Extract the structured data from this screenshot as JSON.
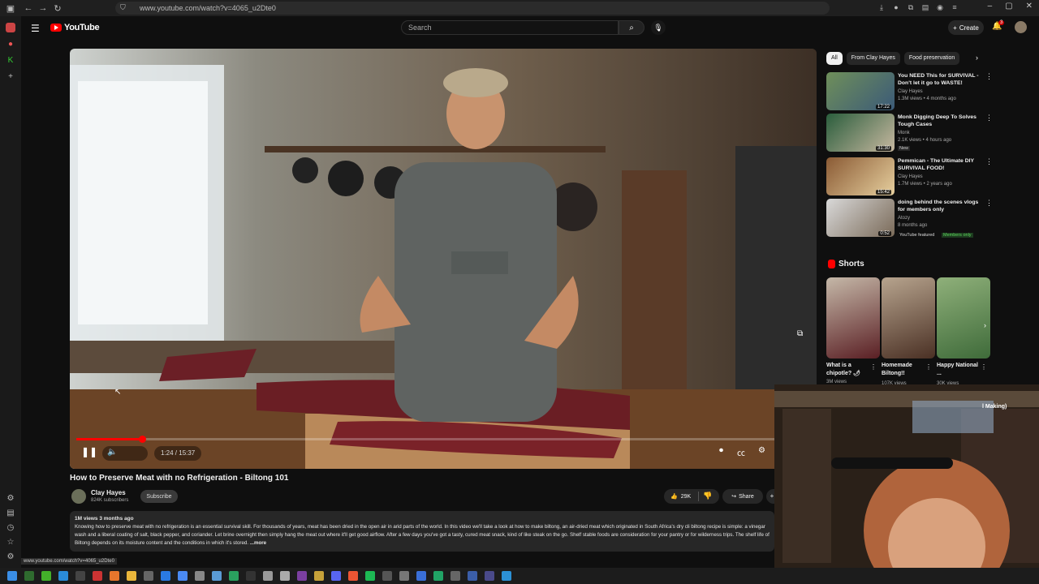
{
  "browser": {
    "url": "www.youtube.com/watch?v=4065_u2Dte0",
    "status_url": "www.youtube.com/watch?v=4065_u2Dte0"
  },
  "header": {
    "logo": "YouTube",
    "search_placeholder": "Search",
    "create_label": "Create",
    "notification_count": "3"
  },
  "player": {
    "time": "1:24 / 15:37",
    "progress": 0.09
  },
  "video": {
    "title": "How to Preserve Meat with no Refrigeration - Biltong 101",
    "channel": "Clay Hayes",
    "subscribers": "824K subscribers",
    "subscribe_label": "Subscribe",
    "likes": "29K",
    "share_label": "Share",
    "description_meta": "1M views  3 months ago",
    "description": "Knowing how to preserve meat with no refrigeration is an essential survival skill. For thousands of years, meat has been dried in the open air in arid parts of the world. In this video we'll take a look at how to make biltong, an air-dried meat which originated in South Africa's dry cli biltong recipe is simple: a vinegar wash and a liberal coating of salt, black pepper, and coriander. Let brine overnight then simply hang the meat out where it'll get good airflow. After a few days you've got a tasty, cured meat snack, kind of like steak on the go. Shelf stable foods are consideration for your pantry or for wilderness trips. The shelf life of Biltong depends on its moisture content and the conditions in which it's stored.",
    "more_label": "...more"
  },
  "chips": [
    "All",
    "From Clay Hayes",
    "Food preservation"
  ],
  "recommendations": [
    {
      "title": "You NEED This for SURVIVAL - Don't let it go to WASTE!",
      "channel": "Clay Hayes",
      "meta": "1.3M views • 4 months ago",
      "duration": "17:22"
    },
    {
      "title": "Monk Digging Deep To Solves Tough Cases",
      "channel": "Monk",
      "meta": "2.1K views • 4 hours ago",
      "duration": "31:30",
      "badge": "New"
    },
    {
      "title": "Pemmican - The Ultimate DIY SURVIVAL FOOD!",
      "channel": "Clay Hayes",
      "meta": "1.7M views • 2 years ago",
      "duration": "15:42"
    },
    {
      "title": "doing behind the scenes vlogs for members only",
      "channel": "Atozy",
      "meta": "8 months ago",
      "duration": "0:52",
      "featured": "YouTube featured",
      "members": "Members only"
    }
  ],
  "shorts": {
    "heading": "Shorts",
    "items": [
      {
        "title": "What is a chipotle? 🌶",
        "views": "3M views"
      },
      {
        "title": "Homemade Biltong!!",
        "views": "107K views"
      },
      {
        "title": "Happy National ...",
        "views": "30K views"
      }
    ],
    "partial_label": "l Making)"
  },
  "colors": {
    "accent": "#ff0000",
    "bg": "#0f0f0f",
    "members": "#5cd65c"
  }
}
